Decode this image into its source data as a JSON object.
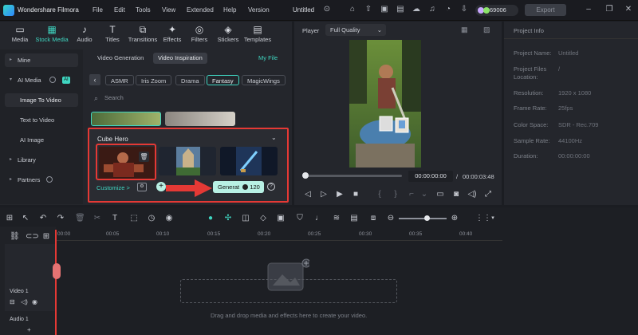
{
  "titlebar": {
    "app_name": "Wondershare Filmora",
    "menu": [
      "File",
      "Edit",
      "Tools",
      "View",
      "Extended",
      "Help",
      "Version"
    ],
    "project_title": "Untitled",
    "credits": "69006",
    "export_label": "Export"
  },
  "toolbar": {
    "tabs": [
      {
        "label": "Media",
        "icon": "media-icon"
      },
      {
        "label": "Stock Media",
        "icon": "stock-media-icon"
      },
      {
        "label": "Audio",
        "icon": "audio-icon"
      },
      {
        "label": "Titles",
        "icon": "titles-icon"
      },
      {
        "label": "Transitions",
        "icon": "transitions-icon"
      },
      {
        "label": "Effects",
        "icon": "effects-icon"
      },
      {
        "label": "Filters",
        "icon": "filters-icon"
      },
      {
        "label": "Stickers",
        "icon": "stickers-icon"
      },
      {
        "label": "Templates",
        "icon": "templates-icon"
      }
    ]
  },
  "sidebar": {
    "mine": "Mine",
    "ai_media": "AI Media",
    "ai_badge": "AI",
    "image_to_video": "Image To Video",
    "text_to_video": "Text to Video",
    "ai_image": "AI Image",
    "library": "Library",
    "partners": "Partners"
  },
  "browser": {
    "subtabs": [
      "Video Generation",
      "Video Inspiration"
    ],
    "my_file": "My File",
    "chips": [
      "ASMR",
      "Iris Zoom",
      "Drama",
      "Fantasy",
      "MagicWings"
    ],
    "search_placeholder": "Search"
  },
  "popup": {
    "title": "Cube Hero",
    "customize": "Customize >",
    "generate_label": "Generat",
    "generate_cost": "120"
  },
  "player": {
    "label": "Player",
    "quality": "Full Quality",
    "current_time": "00:00:00:00",
    "separator": "/",
    "total_time": "00:00:03:48"
  },
  "project_info": {
    "header": "Project Info",
    "rows": [
      {
        "label": "Project Name:",
        "value": "Untitled"
      },
      {
        "label": "Project Files Location:",
        "value": "/"
      },
      {
        "label": "Resolution:",
        "value": "1920 x 1080"
      },
      {
        "label": "Frame Rate:",
        "value": "25fps"
      },
      {
        "label": "Color Space:",
        "value": "SDR - Rec.709"
      },
      {
        "label": "Sample Rate:",
        "value": "44100Hz"
      },
      {
        "label": "Duration:",
        "value": "00:00:00:00"
      }
    ]
  },
  "timeline": {
    "ticks": [
      "00:00",
      "00:05",
      "00:10",
      "00:15",
      "00:20",
      "00:25",
      "00:30",
      "00:35",
      "00:40"
    ],
    "video_track": "Video 1",
    "audio_track": "Audio 1",
    "drop_hint": "Drag and drop media and effects here to create your video."
  },
  "colors": {
    "accent": "#3fd6c1",
    "highlight": "#e53935",
    "generate_bg": "#b8f0e4"
  }
}
